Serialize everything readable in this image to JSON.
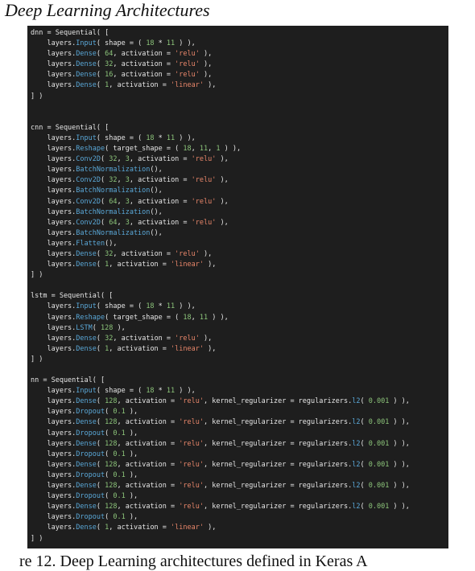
{
  "heading": "Deep Learning Architectures",
  "caption": "re 12. Deep Learning architectures defined in Keras A",
  "code_lines": [
    [
      [
        "dnn = Sequential( [",
        "t"
      ]
    ],
    [
      [
        "    layers.",
        "t"
      ],
      [
        "Input",
        "f"
      ],
      [
        "( shape = ( ",
        "t"
      ],
      [
        "18",
        "n"
      ],
      [
        " * ",
        "t"
      ],
      [
        "11",
        "n"
      ],
      [
        " ) ),",
        "t"
      ]
    ],
    [
      [
        "    layers.",
        "t"
      ],
      [
        "Dense",
        "f"
      ],
      [
        "( ",
        "t"
      ],
      [
        "64",
        "n"
      ],
      [
        ", activation = ",
        "t"
      ],
      [
        "'relu'",
        "s"
      ],
      [
        " ),",
        "t"
      ]
    ],
    [
      [
        "    layers.",
        "t"
      ],
      [
        "Dense",
        "f"
      ],
      [
        "( ",
        "t"
      ],
      [
        "32",
        "n"
      ],
      [
        ", activation = ",
        "t"
      ],
      [
        "'relu'",
        "s"
      ],
      [
        " ),",
        "t"
      ]
    ],
    [
      [
        "    layers.",
        "t"
      ],
      [
        "Dense",
        "f"
      ],
      [
        "( ",
        "t"
      ],
      [
        "16",
        "n"
      ],
      [
        ", activation = ",
        "t"
      ],
      [
        "'relu'",
        "s"
      ],
      [
        " ),",
        "t"
      ]
    ],
    [
      [
        "    layers.",
        "t"
      ],
      [
        "Dense",
        "f"
      ],
      [
        "( ",
        "t"
      ],
      [
        "1",
        "n"
      ],
      [
        ", activation = ",
        "t"
      ],
      [
        "'linear'",
        "s"
      ],
      [
        " ),",
        "t"
      ]
    ],
    [
      [
        "] )",
        "t"
      ]
    ],
    [
      [
        "",
        "t"
      ]
    ],
    [
      [
        "",
        "t"
      ]
    ],
    [
      [
        "cnn = Sequential( [",
        "t"
      ]
    ],
    [
      [
        "    layers.",
        "t"
      ],
      [
        "Input",
        "f"
      ],
      [
        "( shape = ( ",
        "t"
      ],
      [
        "18",
        "n"
      ],
      [
        " * ",
        "t"
      ],
      [
        "11",
        "n"
      ],
      [
        " ) ),",
        "t"
      ]
    ],
    [
      [
        "    layers.",
        "t"
      ],
      [
        "Reshape",
        "f"
      ],
      [
        "( target_shape = ( ",
        "t"
      ],
      [
        "18",
        "n"
      ],
      [
        ", ",
        "t"
      ],
      [
        "11",
        "n"
      ],
      [
        ", ",
        "t"
      ],
      [
        "1",
        "n"
      ],
      [
        " ) ),",
        "t"
      ]
    ],
    [
      [
        "    layers.",
        "t"
      ],
      [
        "Conv2D",
        "f"
      ],
      [
        "( ",
        "t"
      ],
      [
        "32",
        "n"
      ],
      [
        ", ",
        "t"
      ],
      [
        "3",
        "n"
      ],
      [
        ", activation = ",
        "t"
      ],
      [
        "'relu'",
        "s"
      ],
      [
        " ),",
        "t"
      ]
    ],
    [
      [
        "    layers.",
        "t"
      ],
      [
        "BatchNormalization",
        "f"
      ],
      [
        "(),",
        "t"
      ]
    ],
    [
      [
        "    layers.",
        "t"
      ],
      [
        "Conv2D",
        "f"
      ],
      [
        "( ",
        "t"
      ],
      [
        "32",
        "n"
      ],
      [
        ", ",
        "t"
      ],
      [
        "3",
        "n"
      ],
      [
        ", activation = ",
        "t"
      ],
      [
        "'relu'",
        "s"
      ],
      [
        " ),",
        "t"
      ]
    ],
    [
      [
        "    layers.",
        "t"
      ],
      [
        "BatchNormalization",
        "f"
      ],
      [
        "(),",
        "t"
      ]
    ],
    [
      [
        "    layers.",
        "t"
      ],
      [
        "Conv2D",
        "f"
      ],
      [
        "( ",
        "t"
      ],
      [
        "64",
        "n"
      ],
      [
        ", ",
        "t"
      ],
      [
        "3",
        "n"
      ],
      [
        ", activation = ",
        "t"
      ],
      [
        "'relu'",
        "s"
      ],
      [
        " ),",
        "t"
      ]
    ],
    [
      [
        "    layers.",
        "t"
      ],
      [
        "BatchNormalization",
        "f"
      ],
      [
        "(),",
        "t"
      ]
    ],
    [
      [
        "    layers.",
        "t"
      ],
      [
        "Conv2D",
        "f"
      ],
      [
        "( ",
        "t"
      ],
      [
        "64",
        "n"
      ],
      [
        ", ",
        "t"
      ],
      [
        "3",
        "n"
      ],
      [
        ", activation = ",
        "t"
      ],
      [
        "'relu'",
        "s"
      ],
      [
        " ),",
        "t"
      ]
    ],
    [
      [
        "    layers.",
        "t"
      ],
      [
        "BatchNormalization",
        "f"
      ],
      [
        "(),",
        "t"
      ]
    ],
    [
      [
        "    layers.",
        "t"
      ],
      [
        "Flatten",
        "f"
      ],
      [
        "(),",
        "t"
      ]
    ],
    [
      [
        "    layers.",
        "t"
      ],
      [
        "Dense",
        "f"
      ],
      [
        "( ",
        "t"
      ],
      [
        "32",
        "n"
      ],
      [
        ", activation = ",
        "t"
      ],
      [
        "'relu'",
        "s"
      ],
      [
        " ),",
        "t"
      ]
    ],
    [
      [
        "    layers.",
        "t"
      ],
      [
        "Dense",
        "f"
      ],
      [
        "( ",
        "t"
      ],
      [
        "1",
        "n"
      ],
      [
        ", activation = ",
        "t"
      ],
      [
        "'linear'",
        "s"
      ],
      [
        " ),",
        "t"
      ]
    ],
    [
      [
        "] )",
        "t"
      ]
    ],
    [
      [
        "",
        "t"
      ]
    ],
    [
      [
        "lstm = Sequential( [",
        "t"
      ]
    ],
    [
      [
        "    layers.",
        "t"
      ],
      [
        "Input",
        "f"
      ],
      [
        "( shape = ( ",
        "t"
      ],
      [
        "18",
        "n"
      ],
      [
        " * ",
        "t"
      ],
      [
        "11",
        "n"
      ],
      [
        " ) ),",
        "t"
      ]
    ],
    [
      [
        "    layers.",
        "t"
      ],
      [
        "Reshape",
        "f"
      ],
      [
        "( target_shape = ( ",
        "t"
      ],
      [
        "18",
        "n"
      ],
      [
        ", ",
        "t"
      ],
      [
        "11",
        "n"
      ],
      [
        " ) ),",
        "t"
      ]
    ],
    [
      [
        "    layers.",
        "t"
      ],
      [
        "LSTM",
        "f"
      ],
      [
        "( ",
        "t"
      ],
      [
        "128",
        "n"
      ],
      [
        " ),",
        "t"
      ]
    ],
    [
      [
        "    layers.",
        "t"
      ],
      [
        "Dense",
        "f"
      ],
      [
        "( ",
        "t"
      ],
      [
        "32",
        "n"
      ],
      [
        ", activation = ",
        "t"
      ],
      [
        "'relu'",
        "s"
      ],
      [
        " ),",
        "t"
      ]
    ],
    [
      [
        "    layers.",
        "t"
      ],
      [
        "Dense",
        "f"
      ],
      [
        "( ",
        "t"
      ],
      [
        "1",
        "n"
      ],
      [
        ", activation = ",
        "t"
      ],
      [
        "'linear'",
        "s"
      ],
      [
        " ),",
        "t"
      ]
    ],
    [
      [
        "] )",
        "t"
      ]
    ],
    [
      [
        "",
        "t"
      ]
    ],
    [
      [
        "nn = Sequential( [",
        "t"
      ]
    ],
    [
      [
        "    layers.",
        "t"
      ],
      [
        "Input",
        "f"
      ],
      [
        "( shape = ( ",
        "t"
      ],
      [
        "18",
        "n"
      ],
      [
        " * ",
        "t"
      ],
      [
        "11",
        "n"
      ],
      [
        " ) ),",
        "t"
      ]
    ],
    [
      [
        "    layers.",
        "t"
      ],
      [
        "Dense",
        "f"
      ],
      [
        "( ",
        "t"
      ],
      [
        "128",
        "n"
      ],
      [
        ", activation = ",
        "t"
      ],
      [
        "'relu'",
        "s"
      ],
      [
        ", kernel_regularizer = regularizers.",
        "t"
      ],
      [
        "l2",
        "f"
      ],
      [
        "( ",
        "t"
      ],
      [
        "0.001",
        "n"
      ],
      [
        " ) ),",
        "t"
      ]
    ],
    [
      [
        "    layers.",
        "t"
      ],
      [
        "Dropout",
        "f"
      ],
      [
        "( ",
        "t"
      ],
      [
        "0.1",
        "n"
      ],
      [
        " ),",
        "t"
      ]
    ],
    [
      [
        "    layers.",
        "t"
      ],
      [
        "Dense",
        "f"
      ],
      [
        "( ",
        "t"
      ],
      [
        "128",
        "n"
      ],
      [
        ", activation = ",
        "t"
      ],
      [
        "'relu'",
        "s"
      ],
      [
        ", kernel_regularizer = regularizers.",
        "t"
      ],
      [
        "l2",
        "f"
      ],
      [
        "( ",
        "t"
      ],
      [
        "0.001",
        "n"
      ],
      [
        " ) ),",
        "t"
      ]
    ],
    [
      [
        "    layers.",
        "t"
      ],
      [
        "Dropout",
        "f"
      ],
      [
        "( ",
        "t"
      ],
      [
        "0.1",
        "n"
      ],
      [
        " ),",
        "t"
      ]
    ],
    [
      [
        "    layers.",
        "t"
      ],
      [
        "Dense",
        "f"
      ],
      [
        "( ",
        "t"
      ],
      [
        "128",
        "n"
      ],
      [
        ", activation = ",
        "t"
      ],
      [
        "'relu'",
        "s"
      ],
      [
        ", kernel_regularizer = regularizers.",
        "t"
      ],
      [
        "l2",
        "f"
      ],
      [
        "( ",
        "t"
      ],
      [
        "0.001",
        "n"
      ],
      [
        " ) ),",
        "t"
      ]
    ],
    [
      [
        "    layers.",
        "t"
      ],
      [
        "Dropout",
        "f"
      ],
      [
        "( ",
        "t"
      ],
      [
        "0.1",
        "n"
      ],
      [
        " ),",
        "t"
      ]
    ],
    [
      [
        "    layers.",
        "t"
      ],
      [
        "Dense",
        "f"
      ],
      [
        "( ",
        "t"
      ],
      [
        "128",
        "n"
      ],
      [
        ", activation = ",
        "t"
      ],
      [
        "'relu'",
        "s"
      ],
      [
        ", kernel_regularizer = regularizers.",
        "t"
      ],
      [
        "l2",
        "f"
      ],
      [
        "( ",
        "t"
      ],
      [
        "0.001",
        "n"
      ],
      [
        " ) ),",
        "t"
      ]
    ],
    [
      [
        "    layers.",
        "t"
      ],
      [
        "Dropout",
        "f"
      ],
      [
        "( ",
        "t"
      ],
      [
        "0.1",
        "n"
      ],
      [
        " ),",
        "t"
      ]
    ],
    [
      [
        "    layers.",
        "t"
      ],
      [
        "Dense",
        "f"
      ],
      [
        "( ",
        "t"
      ],
      [
        "128",
        "n"
      ],
      [
        ", activation = ",
        "t"
      ],
      [
        "'relu'",
        "s"
      ],
      [
        ", kernel_regularizer = regularizers.",
        "t"
      ],
      [
        "l2",
        "f"
      ],
      [
        "( ",
        "t"
      ],
      [
        "0.001",
        "n"
      ],
      [
        " ) ),",
        "t"
      ]
    ],
    [
      [
        "    layers.",
        "t"
      ],
      [
        "Dropout",
        "f"
      ],
      [
        "( ",
        "t"
      ],
      [
        "0.1",
        "n"
      ],
      [
        " ),",
        "t"
      ]
    ],
    [
      [
        "    layers.",
        "t"
      ],
      [
        "Dense",
        "f"
      ],
      [
        "( ",
        "t"
      ],
      [
        "128",
        "n"
      ],
      [
        ", activation = ",
        "t"
      ],
      [
        "'relu'",
        "s"
      ],
      [
        ", kernel_regularizer = regularizers.",
        "t"
      ],
      [
        "l2",
        "f"
      ],
      [
        "( ",
        "t"
      ],
      [
        "0.001",
        "n"
      ],
      [
        " ) ),",
        "t"
      ]
    ],
    [
      [
        "    layers.",
        "t"
      ],
      [
        "Dropout",
        "f"
      ],
      [
        "( ",
        "t"
      ],
      [
        "0.1",
        "n"
      ],
      [
        " ),",
        "t"
      ]
    ],
    [
      [
        "    layers.",
        "t"
      ],
      [
        "Dense",
        "f"
      ],
      [
        "( ",
        "t"
      ],
      [
        "1",
        "n"
      ],
      [
        ", activation = ",
        "t"
      ],
      [
        "'linear'",
        "s"
      ],
      [
        " ),",
        "t"
      ]
    ],
    [
      [
        "] )",
        "t"
      ]
    ]
  ],
  "colors": {
    "code_background": "#1e1e1e",
    "text": "#e6e6e6",
    "function": "#5aa8d8",
    "string": "#e8866a",
    "number": "#8cc47a"
  }
}
